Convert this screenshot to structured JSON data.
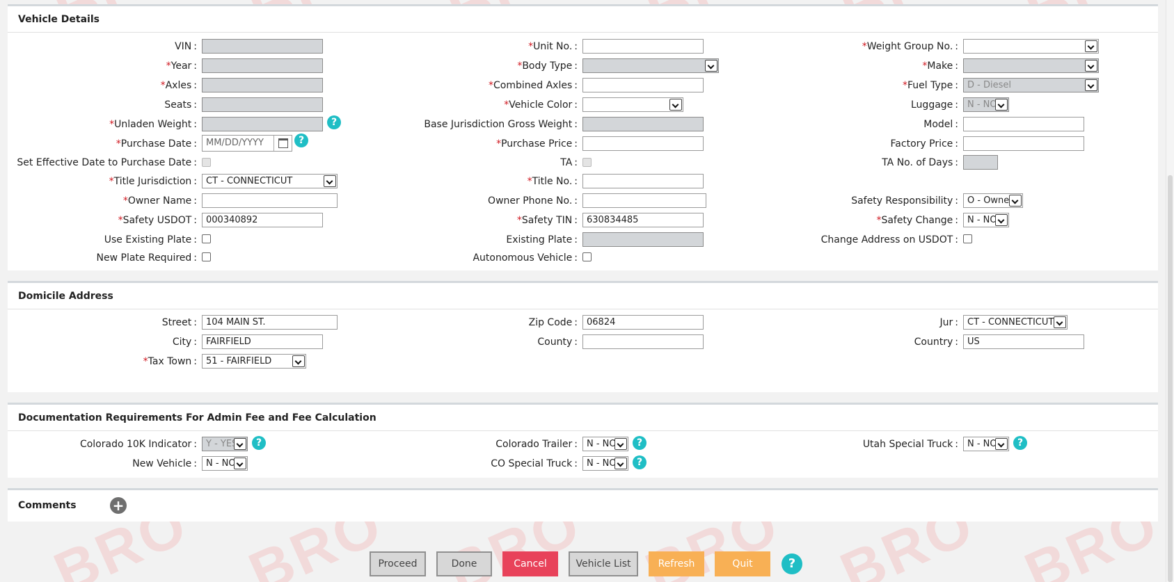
{
  "vehicle": {
    "title": "Vehicle Details",
    "labels": {
      "vin": "VIN",
      "year": "Year",
      "axles": "Axles",
      "seats": "Seats",
      "unladen_weight": "Unladen Weight",
      "purchase_date": "Purchase Date",
      "set_effective_date": "Set Effective Date to Purchase Date",
      "title_jurisdiction": "Title Jurisdiction",
      "owner_name": "Owner Name",
      "safety_usdot": "Safety USDOT",
      "use_existing_plate": "Use Existing Plate",
      "new_plate_required": "New Plate Required",
      "unit_no": "Unit No.",
      "body_type": "Body Type",
      "combined_axles": "Combined Axles",
      "vehicle_color": "Vehicle Color",
      "base_jur_gross_weight": "Base Jurisdiction Gross Weight",
      "purchase_price": "Purchase Price",
      "ta": "TA",
      "title_no": "Title No.",
      "owner_phone": "Owner Phone No.",
      "safety_tin": "Safety TIN",
      "existing_plate": "Existing Plate",
      "autonomous_vehicle": "Autonomous Vehicle",
      "weight_group_no": "Weight Group No.",
      "make": "Make",
      "fuel_type": "Fuel Type",
      "luggage": "Luggage",
      "model": "Model",
      "factory_price": "Factory Price",
      "ta_days": "TA No. of Days",
      "safety_responsibility": "Safety Responsibility",
      "safety_change": "Safety Change",
      "change_address_usdot": "Change Address on USDOT"
    },
    "values": {
      "purchase_date_placeholder": "MM/DD/YYYY",
      "title_jurisdiction": "CT - CONNECTICUT",
      "safety_usdot": "000340892",
      "safety_tin": "630834485",
      "fuel_type": "D - Diesel",
      "luggage": "N - NO",
      "safety_responsibility": "O - Owner",
      "safety_change": "N - NO"
    }
  },
  "domicile": {
    "title": "Domicile Address",
    "labels": {
      "street": "Street",
      "city": "City",
      "tax_town": "Tax Town",
      "zip_code": "Zip Code",
      "county": "County",
      "jur": "Jur",
      "country": "Country"
    },
    "values": {
      "street": "104 MAIN ST.",
      "city": "FAIRFIELD",
      "tax_town": "51 - FAIRFIELD",
      "zip_code": "06824",
      "county": "",
      "jur": "CT - CONNECTICUT",
      "country": "US"
    }
  },
  "documentation": {
    "title": "Documentation Requirements For Admin Fee and Fee Calculation",
    "labels": {
      "colorado_10k": "Colorado 10K Indicator",
      "new_vehicle": "New Vehicle",
      "colorado_trailer": "Colorado Trailer",
      "co_special_truck": "CO Special Truck",
      "utah_special_truck": "Utah Special Truck"
    },
    "values": {
      "colorado_10k": "Y - YES",
      "new_vehicle": "N - NO",
      "colorado_trailer": "N - NO",
      "co_special_truck": "N - NO",
      "utah_special_truck": "N - NO"
    }
  },
  "comments": {
    "title": "Comments"
  },
  "common": {
    "colon": ":",
    "required_mark": "*",
    "help_glyph": "?",
    "plus_glyph": "+",
    "watermark": "BRO"
  },
  "buttons": {
    "proceed": "Proceed",
    "done": "Done",
    "cancel": "Cancel",
    "vehicle_list": "Vehicle List",
    "refresh": "Refresh",
    "quit": "Quit"
  },
  "colors": {
    "accent_teal": "#1fbec5",
    "cancel_red": "#e8425a",
    "action_orange": "#f8b055",
    "required_red": "#d01820"
  }
}
